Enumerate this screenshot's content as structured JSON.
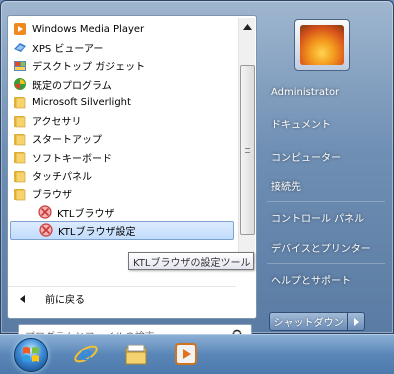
{
  "programs": [
    {
      "label": "Windows Media Player",
      "icon": "media-player-icon",
      "indent": false
    },
    {
      "label": "XPS ビューアー",
      "icon": "xps-viewer-icon",
      "indent": false
    },
    {
      "label": "デスクトップ ガジェット",
      "icon": "gadget-icon",
      "indent": false
    },
    {
      "label": "既定のプログラム",
      "icon": "default-programs-icon",
      "indent": false
    },
    {
      "label": "Microsoft Silverlight",
      "icon": "folder-icon",
      "indent": false
    },
    {
      "label": "アクセサリ",
      "icon": "folder-icon",
      "indent": false
    },
    {
      "label": "スタートアップ",
      "icon": "folder-icon",
      "indent": false
    },
    {
      "label": "ソフトキーボード",
      "icon": "folder-icon",
      "indent": false
    },
    {
      "label": "タッチパネル",
      "icon": "folder-icon",
      "indent": false
    },
    {
      "label": "ブラウザ",
      "icon": "folder-icon",
      "indent": false
    },
    {
      "label": "KTLブラウザ",
      "icon": "ktl-browser-icon",
      "indent": true
    },
    {
      "label": "KTLブラウザ設定",
      "icon": "ktl-browser-icon",
      "indent": true,
      "selected": true
    }
  ],
  "back_label": "前に戻る",
  "search_placeholder": "プログラムとファイルの検索",
  "tooltip": "KTLブラウザの設定ツール",
  "right_items": [
    "Administrator",
    "ドキュメント",
    "コンピューター",
    "接続先",
    "コントロール パネル",
    "デバイスとプリンター",
    "ヘルプとサポート"
  ],
  "shutdown_label": "シャットダウン",
  "colors": {
    "selection_bg": "#c1dcfc",
    "menu_frame": "#5a7ba3",
    "taskbar": "#5a86b7"
  }
}
